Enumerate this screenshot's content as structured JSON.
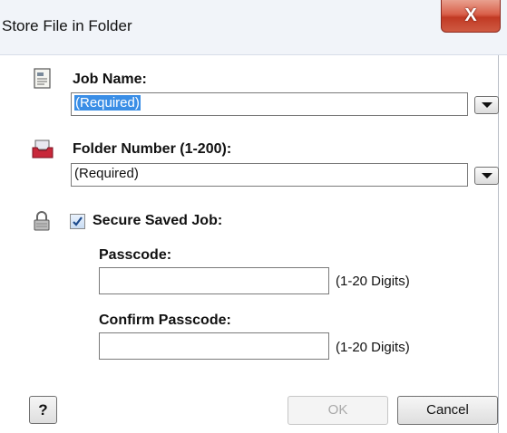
{
  "window": {
    "title": "Store File in Folder",
    "close_glyph": "X"
  },
  "job_name": {
    "label": "Job Name:",
    "value": "(Required)",
    "icon": "document-icon"
  },
  "folder_number": {
    "label": "Folder Number (1-200):",
    "value": "(Required)",
    "icon": "folder-tray-icon"
  },
  "secure": {
    "label": "Secure Saved Job:",
    "checked": true,
    "icon": "lock-icon"
  },
  "passcode": {
    "label": "Passcode:",
    "value": "",
    "hint": "(1-20 Digits)"
  },
  "confirm_passcode": {
    "label": "Confirm Passcode:",
    "value": "",
    "hint": "(1-20 Digits)"
  },
  "footer": {
    "help_label": "?",
    "ok_label": "OK",
    "cancel_label": "Cancel"
  },
  "colors": {
    "selection": "#3a8ee6",
    "close_button": "#c13a24"
  }
}
